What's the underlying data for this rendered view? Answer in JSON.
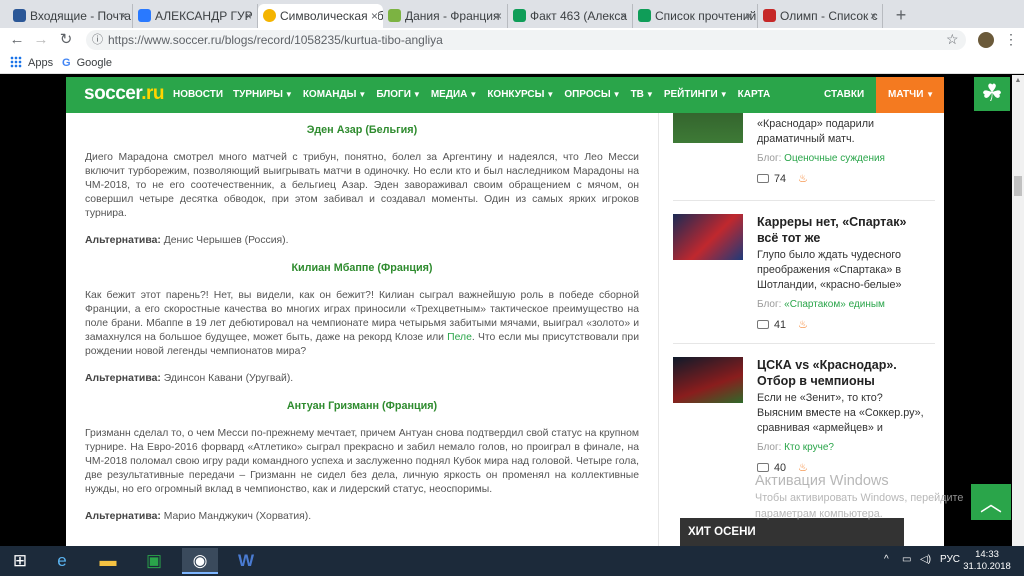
{
  "browser": {
    "tabs": [
      {
        "label": "Входящие - Почта",
        "color": "#2b5797"
      },
      {
        "label": "АЛЕКСАНДР ГУР",
        "color": "#2979ff"
      },
      {
        "label": "Символическая сб",
        "color": "#f4b400",
        "active": true
      },
      {
        "label": "Дания - Франция",
        "color": "#7cb342"
      },
      {
        "label": "Факт 463 (Алекса",
        "color": "#0f9d58"
      },
      {
        "label": "Список прочтений",
        "color": "#0f9d58"
      },
      {
        "label": "Олимп - Список с",
        "color": "#c62828"
      }
    ],
    "tab_close": "×",
    "new_tab": "+",
    "window_controls": [
      "—",
      "❐",
      "✕"
    ],
    "url": "https://www.soccer.ru/blogs/record/1058235/kurtua-tibo-angliya",
    "bookmarks": [
      "Apps",
      "Google"
    ]
  },
  "site": {
    "logo_main": "soccer",
    "logo_tld": ".ru",
    "nav": [
      "НОВОСТИ",
      "ТУРНИРЫ",
      "КОМАНДЫ",
      "БЛОГИ",
      "МЕДИА",
      "КОНКУРСЫ",
      "ОПРОСЫ",
      "ТВ",
      "РЕЙТИНГИ",
      "КАРТА"
    ],
    "nav_dropdown": [
      false,
      true,
      true,
      true,
      true,
      true,
      true,
      true,
      true,
      false
    ],
    "stavki": "СТАВКИ",
    "matchi": "МАТЧИ",
    "accent": "#2aa54a",
    "orange": "#f47a20"
  },
  "article": {
    "blocks": [
      {
        "type": "player",
        "text": "Эден Азар (Бельгия)"
      },
      {
        "type": "para",
        "text": "Диего Марадона смотрел много матчей с трибун, понятно, болел за Аргентину и надеялся, что Лео Месси включит турборежим, позволяющий выигрывать матчи в одиночку. Но если кто и был наследником Марадоны на ЧМ-2018, то не его соотечественник, а бельгиец Азар. Эден завораживал своим обращением с мячом, он совершил четыре десятка обводок, при этом забивал и создавал моменты. Один из самых ярких игроков турнира."
      },
      {
        "type": "alt",
        "label": "Альтернатива:",
        "text": " Денис Черышев (Россия)."
      },
      {
        "type": "player",
        "text": "Килиан Мбаппе (Франция)"
      },
      {
        "type": "para",
        "text_before": "Как бежит этот парень?! Нет, вы видели, как он бежит?! Килиан сыграл важнейшую роль в победе сборной Франции, а его скоростные качества во многих играх приносили «Трехцветным» тактическое преимущество на поле брани. Мбаппе в 19 лет дебютировал на чемпионате мира четырьмя забитыми мячами, выиграл «золото» и замахнулся на большое будущее, может быть, даже на рекорд Клозе или ",
        "link": "Пеле",
        "text_after": ". Что если мы присутствовали при рождении новой легенды чемпионатов мира?"
      },
      {
        "type": "alt",
        "label": "Альтернатива:",
        "text": " Эдинсон Кавани (Уругвай)."
      },
      {
        "type": "player",
        "text": "Антуан Гризманн (Франция)"
      },
      {
        "type": "para",
        "text": "Гризманн сделал то, о чем Месси по-прежнему мечтает, причем Антуан снова подтвердил свой статус на крупном турнире. На Евро-2016 форвард «Атлетико» сыграл прекрасно и забил немало голов, но проиграл в финале, на ЧМ-2018 поломал свою игру ради командного успеха и заслуженно поднял Кубок мира над головой. Четыре гола, две результативные передачи – Гризманн не сидел без дела, личную яркость он променял на коллективные нужды, но его огромный вклад в чемпионство, как и лидерский статус, неоспоримы."
      },
      {
        "type": "alt",
        "label": "Альтернатива:",
        "text": " Марио Манджукич (Хорватия)."
      }
    ]
  },
  "sidebar": {
    "cards": [
      {
        "title": "",
        "desc": "«Краснодар» подарили драматичный матч.",
        "blog_prefix": "Блог: ",
        "blog_name": "Оценочные суждения",
        "comments": "74"
      },
      {
        "title": "Карреры нет, «Спартак» всё тот же",
        "desc": "Глупо было ждать чудесного преображения «Спартака» в Шотландии, «красно-белые»",
        "blog_prefix": "Блог: ",
        "blog_name": "«Спартаком» единым",
        "comments": "41"
      },
      {
        "title": "ЦСКА vs «Краснодар». Отбор в чемпионы",
        "desc": "Если не «Зенит», то кто? Выясним вместе на «Соккер.ру», сравнивая «армейцев» и",
        "blog_prefix": "Блог: ",
        "blog_name": "Кто круче?",
        "comments": "40"
      }
    ],
    "hit": "ХИТ ОСЕНИ"
  },
  "overlay": {
    "activation_title": "Активация Windows",
    "activation_line1": "Чтобы активировать Windows, перейдите",
    "activation_line2": "параметрам компьютера."
  },
  "taskbar": {
    "lang": "РУС",
    "time": "14:33",
    "date": "31.10.2018"
  }
}
